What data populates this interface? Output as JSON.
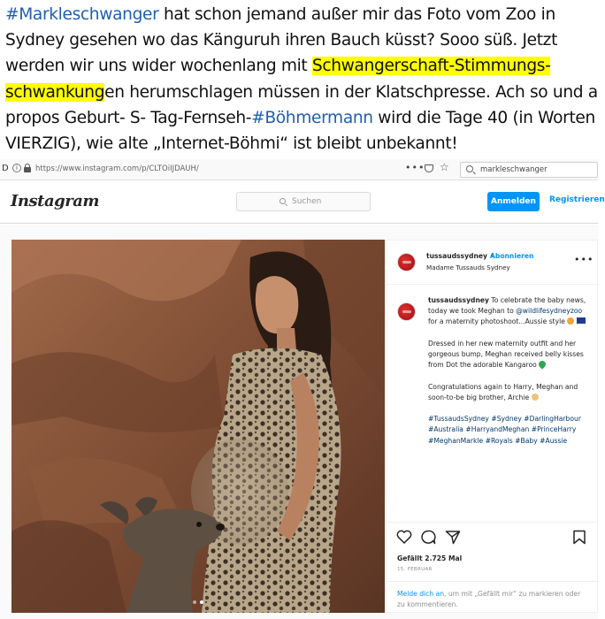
{
  "caption": {
    "hashtag1": "#Markleschwanger",
    "text1": " hat schon jemand außer mir das Foto vom Zoo in Sydney gesehen wo das Känguruh ihren Bauch küsst? Sooo süß. Jetzt werden wir uns wider wochenlang mit ",
    "highlight1": "Schwangerschaft-Stimmungs-",
    "highlight2": "schwankung",
    "text2": "en herumschlagen müssen in der Klatschpresse. Ach so und a propos Geburt- S- Tag-Fernseh-",
    "hashtag2": "#Böhmermann",
    "text3": " wird die Tage 40 (in Worten VIERZIG), wie alte „Internet-Böhmi“ ist bleibt unbekannt!",
    "highlight_color": "#ffff00",
    "hashtag_color": "#1f5fb0"
  },
  "browser": {
    "url": "https://www.instagram.com/p/CLTOiIJDAUH/",
    "menu_dots": "•••",
    "search_value": "markleschwanger"
  },
  "instagram": {
    "logo": "Instagram",
    "search_placeholder": "Suchen",
    "login_label": "Anmelden",
    "register_label": "Registrieren",
    "accent_color": "#0095f6"
  },
  "post": {
    "username": "tussaudssydney",
    "separator": "•",
    "follow_label": "Abonnieren",
    "location": "Madame Tussauds Sydney",
    "more": "•••",
    "caption_user": "tussaudssydney",
    "caption_part1": " To celebrate the baby news, today we took Meghan to ",
    "caption_mention": "@wildlifesydneyzoo",
    "caption_part2": " for a maternity photoshoot...Aussie style ",
    "caption_para2": "Dressed in her new maternity outfit and her gorgeous bump, Meghan received belly kisses from Dot the adorable Kangaroo ",
    "caption_para3": "Congratulations again to Harry, Meghan and soon-to-be big brother, Archie ",
    "hashtags": "#TussaudsSydney #Sydney #DarlingHarbour #Australia #HarryandMeghan #PrinceHarry #MeghanMarkle #Royals #Baby #Aussie",
    "likes": "Gefällt 2.725 Mal",
    "date": "15. FEBRUAR",
    "login_link": "Melde dich an",
    "login_text": ", um mit „Gefällt mir“ zu markieren oder zu kommentieren."
  }
}
